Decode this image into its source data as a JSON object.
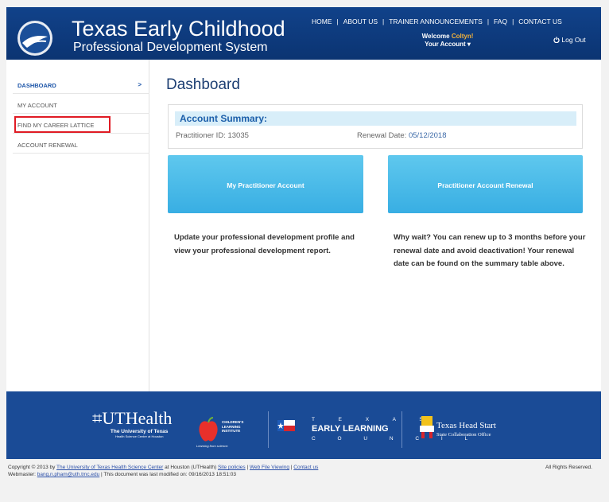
{
  "header": {
    "title_line1": "Texas Early Childhood",
    "title_line2": "Professional Development System",
    "nav": [
      "HOME",
      "ABOUT US",
      "TRAINER ANNOUNCEMENTS",
      "FAQ",
      "CONTACT US"
    ],
    "welcome_prefix": "Welcome ",
    "welcome_name": "Coltyn!",
    "account_label": "Your Account",
    "logout_label": "Log Out"
  },
  "sidebar": {
    "items": [
      {
        "label": "DASHBOARD"
      },
      {
        "label": "MY ACCOUNT"
      },
      {
        "label": "FIND MY CAREER LATTICE"
      },
      {
        "label": "ACCOUNT RENEWAL"
      }
    ],
    "chevron": ">"
  },
  "main": {
    "title": "Dashboard",
    "summary": {
      "heading": "Account Summary:",
      "practitioner_label": "Practitioner ID: 13035",
      "renewal_label": "Renewal Date: ",
      "renewal_date": "05/12/2018"
    },
    "buttons": [
      {
        "label": "My Practitioner Account"
      },
      {
        "label": "Practitioner Account Renewal"
      }
    ],
    "descriptions": [
      "Update your professional development profile and view your professional development report.",
      "Why wait? You can renew up to 3 months before your renewal date and avoid deactivation! Your renewal date can be found on the summary table above."
    ]
  },
  "footer": {
    "ut_name": "UTHealth",
    "ut_sub": "The University of Texas",
    "ut_sub2": "Health Science Center at Houston",
    "cli_lines": [
      "CHILDREN'S",
      "LEARNING",
      "INSTITUTE"
    ],
    "cli_tag": "Learning from science.",
    "telc_top": "T E X A S",
    "telc_mid": "EARLY LEARNING",
    "telc_bot": "C O U N C I L",
    "ths_title": "Texas Head Start",
    "ths_sub": "State Collaboration Office",
    "copyright_prefix": "Copyright © 2013 by ",
    "copyright_link": "The University of Texas Health Science Center",
    "copyright_mid": " at Houston (UTHealth)   ",
    "links": [
      "Site policies",
      "Web File Viewing",
      "Contact us"
    ],
    "webmaster_prefix": "Webmaster: ",
    "webmaster_email": "bang.n.pham@uth.tmc.edu",
    "modified": " | This document was last modified on: 09/16/2013 18:51:03",
    "rights": "All Rights Reserved."
  },
  "colors": {
    "header_blue": "#0f3d80",
    "button_blue": "#4bbbe9",
    "highlight_red": "#e01b24",
    "welcome_name": "#f2b13a"
  }
}
